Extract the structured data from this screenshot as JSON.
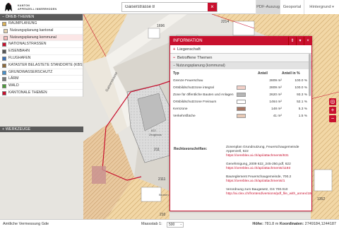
{
  "header": {
    "logo_line1": "KANTON",
    "logo_line2": "APPENZELL INNERRHODEN",
    "search_value": "Gaiserstrasse 8",
    "search_clear": "×",
    "buttons": {
      "pdf": "PDF-Auszug",
      "geoportal": "Geoportal",
      "background": "Hintergrund",
      "background_caret": "▾"
    }
  },
  "sidebar": {
    "oereb_title": "− ÖREB-THEMEN",
    "items": [
      {
        "label": "RAUMPLANUNG",
        "icon_color": "#d9b15a",
        "sub": false,
        "selected": false
      },
      {
        "label": "Nutzungsplanung kantonal",
        "icon_color": "#e6d2b0",
        "sub": true,
        "selected": false
      },
      {
        "label": "Nutzungsplanung kommunal",
        "icon_color": "#f5b7b7",
        "sub": true,
        "selected": true
      },
      {
        "label": "NATIONALSTRASSEN",
        "icon_color": "#c8102e",
        "sub": false,
        "selected": false
      },
      {
        "label": "EISENBAHN",
        "icon_color": "#555555",
        "sub": false,
        "selected": false
      },
      {
        "label": "FLUGHAFEN",
        "icon_color": "#3a6fb5",
        "sub": false,
        "selected": false
      },
      {
        "label": "KATASTER BELASTETE STANDORTE (KBS)",
        "icon_color": "#8e6a3a",
        "sub": false,
        "selected": false
      },
      {
        "label": "GRUNDWASSERSCHUTZ",
        "icon_color": "#4a90c8",
        "sub": false,
        "selected": false
      },
      {
        "label": "LÄRM",
        "icon_color": "#7a7a7a",
        "sub": false,
        "selected": false
      },
      {
        "label": "WALD",
        "icon_color": "#4c9a3a",
        "sub": false,
        "selected": false
      },
      {
        "label": "KANTONALE THEMEN",
        "icon_color": "#c8102e",
        "sub": false,
        "selected": false
      }
    ],
    "werkzeuge": "+ WERKZEUGE"
  },
  "map": {
    "labels": {
      "gaiserstrasse": "Gaiserstrasse",
      "zeughaus": "Zeughaus",
      "l1696": "1696",
      "l2214": "2214",
      "l211": "211",
      "l2111": "2111",
      "l210": "210",
      "l622": "622",
      "l1352": "1352",
      "blumen": "Blumen"
    }
  },
  "controls": {
    "locate": "◎",
    "zoom_in": "+",
    "zoom_out": "−"
  },
  "info": {
    "title": "INFORMATION",
    "header_buttons": [
      "⇕",
      "▾",
      "×"
    ],
    "liegenschaft": "Liegenschaft",
    "betroffene": "Betroffene Themen",
    "subhead": "− Nutzungsplanung (kommunal)",
    "columns": {
      "typ": "Typ",
      "anteil": "Anteil",
      "prozent": "Anteil in %"
    },
    "rows": [
      {
        "typ": "Grenze Feuerschau",
        "color": "",
        "anteil": "2809 m²",
        "prozent": "100.0 %"
      },
      {
        "typ": "Ortsbildschutzzone integral",
        "color": "#f2d0c8",
        "anteil": "2809 m²",
        "prozent": "100.0 %"
      },
      {
        "typ": "Zone für öffentliche Bauten und Anlagen",
        "color": "#b5b5b5",
        "anteil": "2620 m²",
        "prozent": "93.3 %"
      },
      {
        "typ": "Ortsbildschutzzone Freiraum",
        "color": "#ffffff",
        "anteil": "1464 m²",
        "prozent": "52.1 %"
      },
      {
        "typ": "Kernzone",
        "color": "#a87562",
        "anteil": "148 m²",
        "prozent": "5.3 %"
      },
      {
        "typ": "Verkehrsfläche",
        "color": "#e8c9b5",
        "anteil": "41 m²",
        "prozent": "1.5 %"
      }
    ],
    "rechtsvorschriften_label": "Rechtsvorschriften:",
    "rechtsvorschriften": [
      {
        "text": "Zonenplan Grundnutzung, Feuerschaugemeinde Appenzell, 622",
        "link": "https://oereblex.ai.ch/api/attachments/831"
      },
      {
        "text": "Genehmigung_2009 622_245-250.pdf, 622",
        "link": "https://oereblex.ai.ch/api/attachments/1193"
      },
      {
        "text": "Baureglement Feuerschaugemeinde, 700.2",
        "link": "https://oereblex.ai.ch/api/attachments/1"
      },
      {
        "text": "Verordnung zum Baugesetz, GS 700.010",
        "link": "http://ai.clex.ch/frontend/versions/pdf_file_with_annex/186"
      }
    ]
  },
  "footer": {
    "left": "Amtliche Vermessung Gde",
    "scale_label": "Massstab 1:",
    "scale_value": "500",
    "scale_caret": "⌃",
    "right_label_hohe": "Höhe:",
    "right_hohe": "781.8 m",
    "right_label_koord": "Koordinaten:",
    "right_koord": "2749184,1244187"
  },
  "colors": {
    "accent": "#c8102e"
  }
}
